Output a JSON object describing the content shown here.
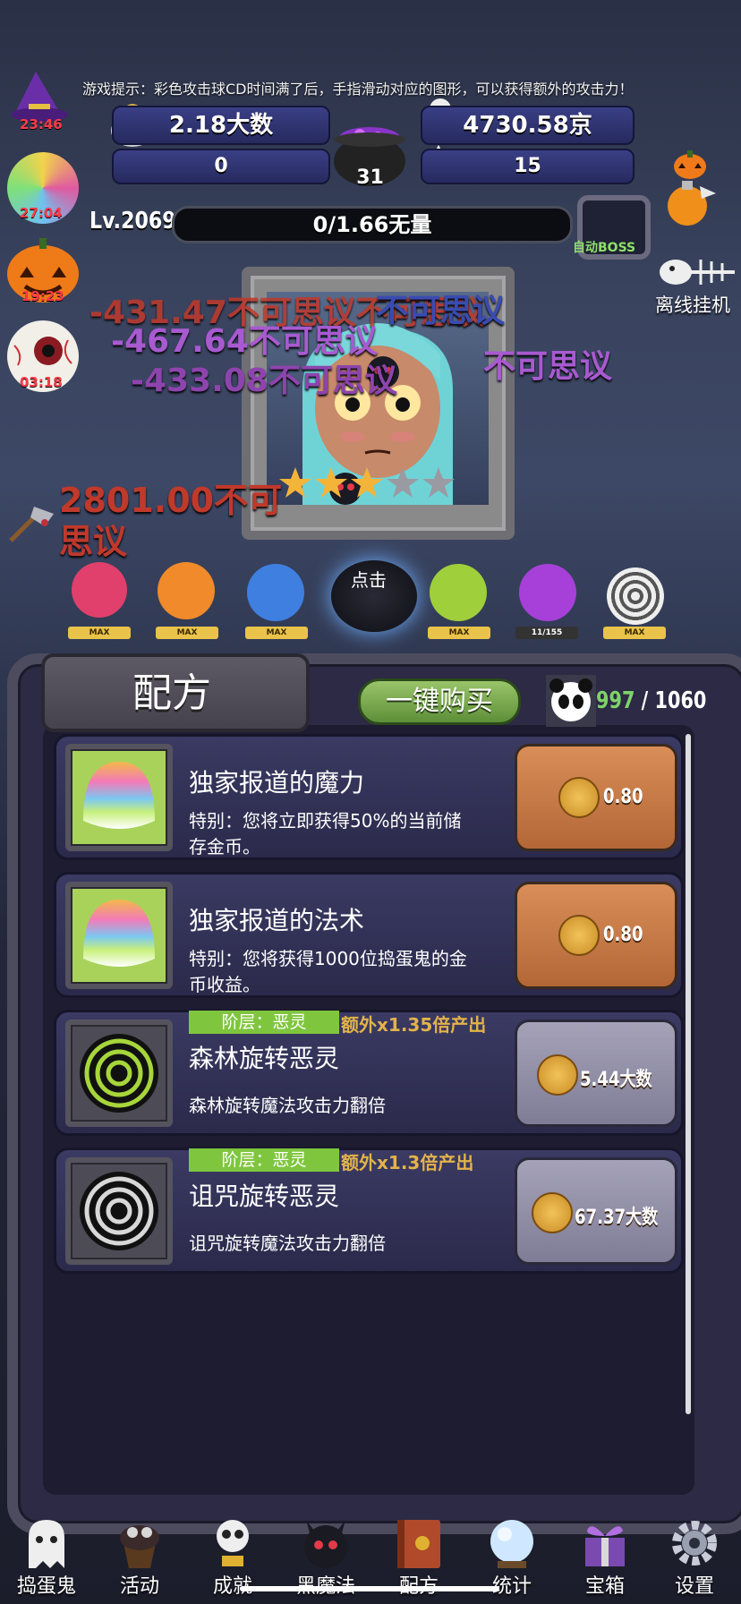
{
  "hud": {
    "tip": "游戏提示：彩色攻击球CD时间满了后，手指滑动对应的图形，可以获得额外的攻击力！",
    "coins": "2.18大数",
    "skull_currency": "4730.58京",
    "bow_count": "0",
    "candy_count": "15",
    "cauldron_count": "31",
    "level": "Lv.2069",
    "xp": "0/1.66无量",
    "auto_boss": "自动BOSS",
    "offline": "离线挂机"
  },
  "timers": [
    "23:46",
    "27:04",
    "19:23",
    "03:18"
  ],
  "damage_texts": [
    {
      "text": "-431.47不可思议不可思议",
      "color": "#c0392b"
    },
    {
      "text": "-467.64不可思议",
      "color": "#9b59b6"
    },
    {
      "text": "-433.08不可思议",
      "color": "#8e44ad"
    },
    {
      "text": "不可思议",
      "color": "#2c3e9e"
    },
    {
      "text": "不可思议",
      "color": "#8e44ad"
    },
    {
      "text": "2801.00不可思议",
      "color": "#c0392b"
    }
  ],
  "creatures": [
    {
      "label": "MAX",
      "color": "#e0406b"
    },
    {
      "label": "MAX",
      "color": "#f08a2a"
    },
    {
      "label": "MAX",
      "color": "#3f7fe0"
    },
    {
      "label": "点击",
      "color": "#1b1b24"
    },
    {
      "label": "MAX",
      "color": "#9fcf3a"
    },
    {
      "label": "11/155",
      "color": "#a640d8"
    },
    {
      "label": "MAX",
      "color": "#cfcfcf"
    }
  ],
  "recipe": {
    "title": "配方",
    "buy_all": "一键购买",
    "capacity_used": "997",
    "capacity_sep": " / ",
    "capacity_total": "1060",
    "items": [
      {
        "name": "独家报道的魔力",
        "desc_1": "特别：您将立即获得50%的当前储",
        "desc_2": "存金币。",
        "price": "0.80",
        "tier": "",
        "bonus": ""
      },
      {
        "name": "独家报道的法术",
        "desc_1": "特别：您将获得1000位捣蛋鬼的金",
        "desc_2": "币收益。",
        "price": "0.80",
        "tier": "",
        "bonus": ""
      },
      {
        "name": "森林旋转恶灵",
        "desc_1": "森林旋转魔法攻击力翻倍",
        "desc_2": "",
        "price": "5.44大数",
        "tier": "阶层：恶灵",
        "bonus": "额外x1.35倍产出"
      },
      {
        "name": "诅咒旋转恶灵",
        "desc_1": "诅咒旋转魔法攻击力翻倍",
        "desc_2": "",
        "price": "67.37大数",
        "tier": "阶层：恶灵",
        "bonus": "额外x1.3倍产出"
      }
    ]
  },
  "nav": [
    "捣蛋鬼",
    "活动",
    "成就",
    "黑魔法",
    "配方",
    "统计",
    "宝箱",
    "设置"
  ],
  "icons": [
    "ghost-icon",
    "cupcake-icon",
    "skull-trophy-icon",
    "demon-icon",
    "book-icon",
    "crystal-ball-icon",
    "gift-box-icon",
    "gear-icon"
  ]
}
